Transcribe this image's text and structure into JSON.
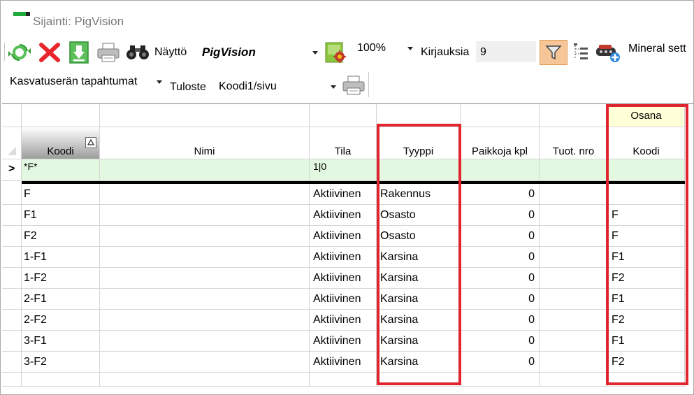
{
  "window": {
    "title": "Sijainti: PigVision"
  },
  "toolbar": {
    "nayttö_label": "Näyttö",
    "nayttö_value": "PigVision",
    "zoom_value": "100%",
    "kirjauksia_label": "Kirjauksia",
    "kirjauksia_value": "9",
    "mineral_label": "Mineral sett"
  },
  "toolbar2": {
    "events_menu": "Kasvatuserän tapahtumat",
    "tuloste_label": "Tuloste",
    "tuloste_value": "Koodi1/sivu"
  },
  "grid": {
    "group_header": "Osana",
    "columns": [
      "Koodi",
      "Nimi",
      "Tila",
      "Tyyppi",
      "Paikkoja kpl",
      "Tuot. nro",
      "Koodi"
    ],
    "filter_row": {
      "indicator": ">",
      "koodi": "*F*",
      "tila": "1|0"
    },
    "rows": [
      {
        "koodi": "F",
        "nimi": "",
        "tila": "Aktiivinen",
        "tyyppi": "Rakennus",
        "paikkoja": "0",
        "tuot": "",
        "osana": ""
      },
      {
        "koodi": "F1",
        "nimi": "",
        "tila": "Aktiivinen",
        "tyyppi": "Osasto",
        "paikkoja": "0",
        "tuot": "",
        "osana": "F"
      },
      {
        "koodi": "F2",
        "nimi": "",
        "tila": "Aktiivinen",
        "tyyppi": "Osasto",
        "paikkoja": "0",
        "tuot": "",
        "osana": "F"
      },
      {
        "koodi": "1-F1",
        "nimi": "",
        "tila": "Aktiivinen",
        "tyyppi": "Karsina",
        "paikkoja": "0",
        "tuot": "",
        "osana": "F1"
      },
      {
        "koodi": "1-F2",
        "nimi": "",
        "tila": "Aktiivinen",
        "tyyppi": "Karsina",
        "paikkoja": "0",
        "tuot": "",
        "osana": "F2"
      },
      {
        "koodi": "2-F1",
        "nimi": "",
        "tila": "Aktiivinen",
        "tyyppi": "Karsina",
        "paikkoja": "0",
        "tuot": "",
        "osana": "F1"
      },
      {
        "koodi": "2-F2",
        "nimi": "",
        "tila": "Aktiivinen",
        "tyyppi": "Karsina",
        "paikkoja": "0",
        "tuot": "",
        "osana": "F2"
      },
      {
        "koodi": "3-F1",
        "nimi": "",
        "tila": "Aktiivinen",
        "tyyppi": "Karsina",
        "paikkoja": "0",
        "tuot": "",
        "osana": "F1"
      },
      {
        "koodi": "3-F2",
        "nimi": "",
        "tila": "Aktiivinen",
        "tyyppi": "Karsina",
        "paikkoja": "0",
        "tuot": "",
        "osana": "F2"
      }
    ]
  },
  "colors": {
    "highlight_red": "#e0252e",
    "filter_row_bg": "#e3f8e0",
    "group_header_bg": "#ffffd8",
    "filter_button_bg": "#f7c698"
  },
  "icons": [
    "refresh-icon",
    "delete-icon",
    "download-icon",
    "printer-icon",
    "binoculars-icon",
    "view-settings-icon",
    "filter-icon",
    "tree-icon",
    "machine-add-icon",
    "printer-icon"
  ]
}
